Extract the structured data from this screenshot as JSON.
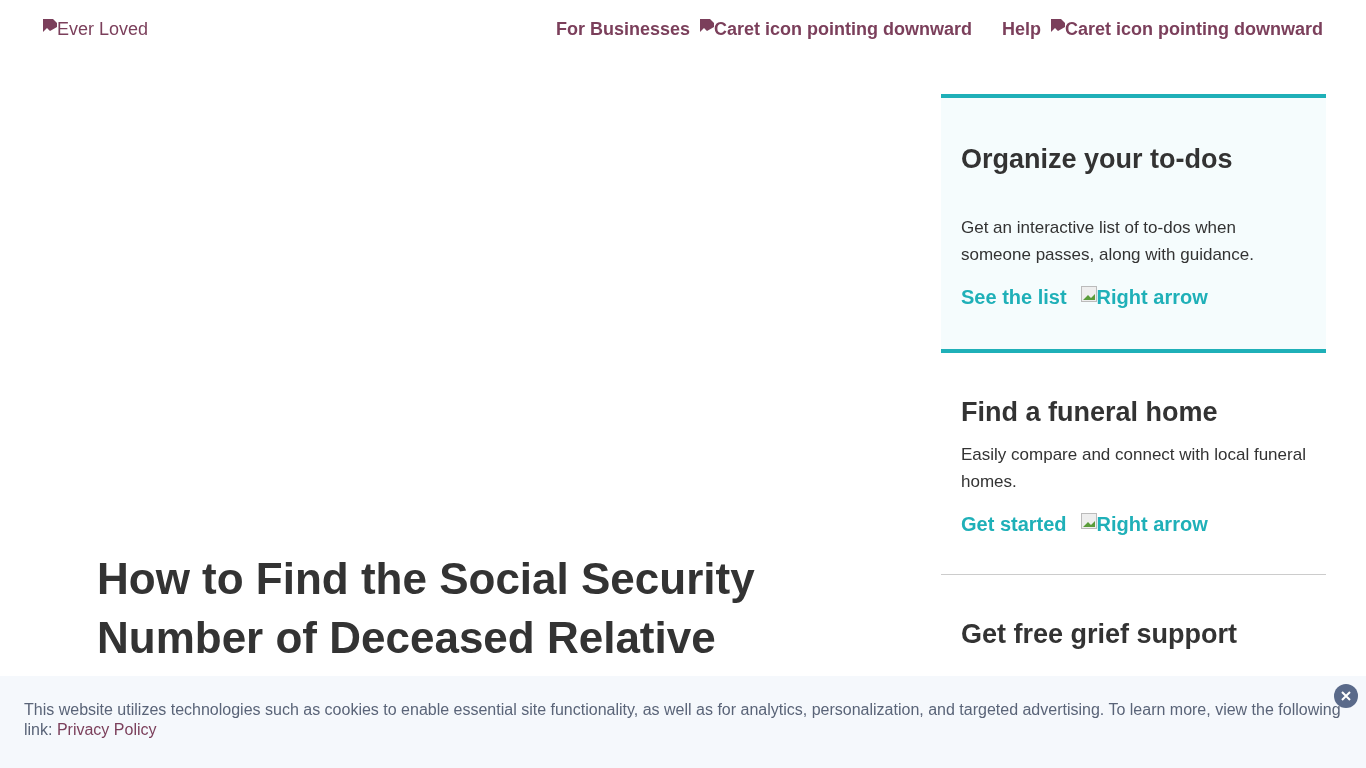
{
  "header": {
    "logo": {
      "alt": "Ever Loved"
    },
    "nav": [
      {
        "label": "For Businesses",
        "caret_alt": "Caret icon pointing downward"
      },
      {
        "label": "Help",
        "caret_alt": "Caret icon pointing downward"
      }
    ]
  },
  "article": {
    "title": "How to Find the Social Security Number of Deceased Relative"
  },
  "sidebar": {
    "cards": [
      {
        "title": "Organize your to-dos",
        "text": "Get an interactive list of to-dos when someone passes, along with guidance.",
        "link": "See the list",
        "arrow_alt": "Right arrow",
        "highlighted": true
      },
      {
        "title": "Find a funeral home",
        "text": "Easily compare and connect with local funeral homes.",
        "link": "Get started",
        "arrow_alt": "Right arrow",
        "highlighted": false
      },
      {
        "title": "Get free grief support",
        "highlighted": false
      }
    ]
  },
  "cookie_banner": {
    "text": "This website utilizes technologies such as cookies to enable essential site functionality, as well as for analytics, personalization, and targeted advertising. To learn more, view the following link:",
    "link": "Privacy Policy"
  }
}
